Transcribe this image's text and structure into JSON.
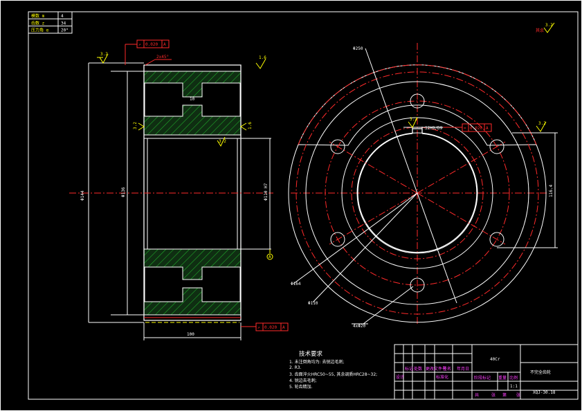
{
  "param_table": {
    "rows": [
      {
        "label": "模数 m",
        "value": "4"
      },
      {
        "label": "齿数 z",
        "value": "34"
      },
      {
        "label": "压力角 α",
        "value": "20°"
      }
    ]
  },
  "roughness_corner": "3.2",
  "roughness_corner_note": "其余",
  "section_view": {
    "roughness_left": "3.2",
    "roughness_right": "1.6",
    "tolerance_top": {
      "sym": "↗",
      "value": "0.020",
      "datum": "A"
    },
    "tolerance_bottom": {
      "sym": "↗",
      "value": "0.020",
      "datum": "A"
    },
    "chamfer": "2x45°",
    "dim_width": "100",
    "dim_outer": "Φ144",
    "dim_root": "Φ136",
    "dim_bore": "Φ110 H7",
    "dim_small": "10",
    "roughness_hub_left": "3.2",
    "roughness_hub_right": "1.6",
    "roughness_bore": "3.2",
    "datum_label": "A"
  },
  "front_view": {
    "dim_outer": "Φ250",
    "dim_pcd": "Φ164",
    "dim_hub": "Φ110",
    "dim_holes": "4xΦ20",
    "keyway": "32H9/D9",
    "tolerance": {
      "sym": "=",
      "value": "0.020",
      "datum": "A"
    },
    "roughness_key": "3.2",
    "roughness_right": "3.2",
    "dim_keyway_depth": "116.4"
  },
  "tech_req": {
    "title": "技术要求",
    "lines": [
      "1. 未注倒角均为: 去锐边毛刺;",
      "2. R3.",
      "3. 齿面淬火HRC50~55, 其余调质HRC28~32;",
      "4. 锐边去毛刺;",
      "5. 轮齿精加."
    ]
  },
  "title_block": {
    "material": "40Cr",
    "part_name": "不完全齿轮",
    "scale": "1:1",
    "drawing_no": "XQJ-30.18",
    "headers": [
      "标记",
      "处数",
      "更改文件号",
      "签名",
      "年月日"
    ],
    "designer": "设计",
    "standardize": "标准化",
    "stage_mark": "阶段标记",
    "weight": "重量",
    "scale_label": "比例",
    "sheet_total": "共",
    "sheet": "张",
    "sheet_no": "第",
    "sheet_unit": "张"
  }
}
